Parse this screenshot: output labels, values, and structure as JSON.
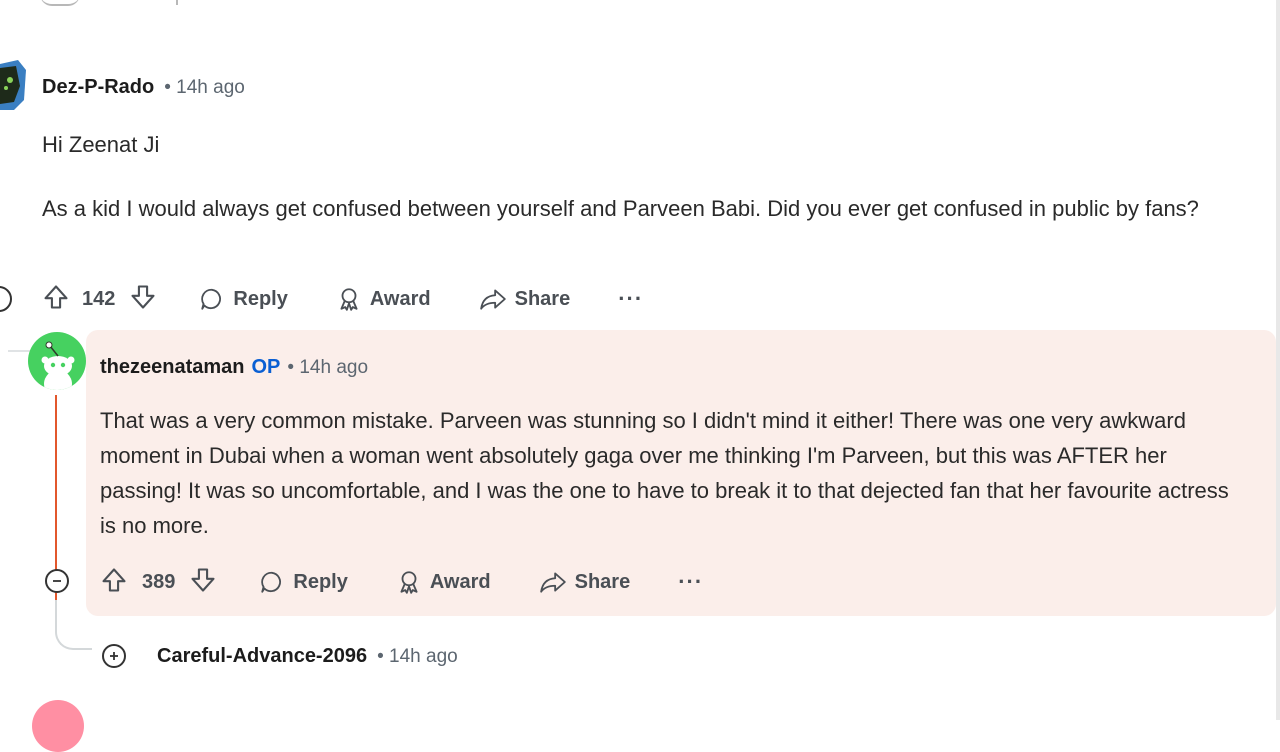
{
  "comments": [
    {
      "author": "Dez-P-Rado",
      "time": "• 14h ago",
      "paragraphs": [
        "Hi Zeenat Ji",
        "As a kid I would always get confused between yourself and Parveen Babi. Did you ever get confused in public by fans?"
      ],
      "votes": "142"
    },
    {
      "author": "thezeenataman",
      "op_badge": "OP",
      "time": "• 14h ago",
      "body": "That was a very common mistake. Parveen was stunning so I didn't mind it either! There was one very awkward moment in Dubai when a woman went absolutely gaga over me thinking I'm Parveen, but this was AFTER her passing! It was so uncomfortable, and I was the one to have to break it to that dejected fan that her favourite actress is no more.",
      "votes": "389"
    },
    {
      "author": "Careful-Advance-2096",
      "time": "• 14h ago"
    }
  ],
  "actions": {
    "reply": "Reply",
    "award": "Award",
    "share": "Share",
    "more": "···"
  },
  "icons": [
    "upvote-icon",
    "downvote-icon",
    "reply-icon",
    "award-icon",
    "share-icon",
    "collapse-icon",
    "expand-icon"
  ],
  "colors": {
    "thread_line": "#e2572c",
    "highlight_bg": "#fbeeea",
    "op_badge": "#0a5fd3",
    "avatar_green": "#46d160"
  }
}
